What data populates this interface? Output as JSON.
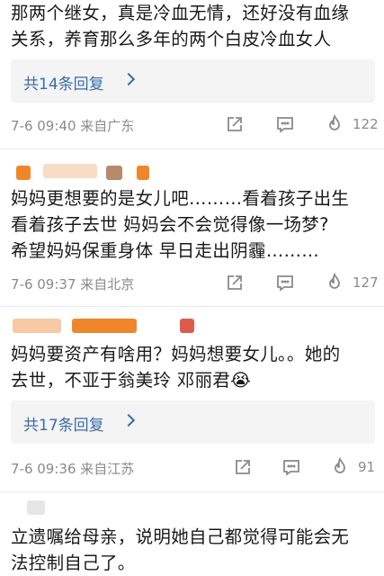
{
  "comments": [
    {
      "text": "那两个继女，真是冷血无情，还好没有血缘\n关系，养育那么多年的两个白皮冷血女人",
      "replies": "共14条回复",
      "meta": "7-6 09:40  来自广东",
      "likes": "122"
    },
    {
      "text": "妈妈更想要的是女儿吧………看着孩子出生\n看着孩子去世 妈妈会不会觉得像一场梦?\n希望妈妈保重身体 早日走出阴霾………",
      "meta": "7-6 09:37  来自北京",
      "likes": "127"
    },
    {
      "text": "妈妈要资产有啥用？妈妈想要女儿。。她的\n去世，不亚于翁美玲 邓丽君😭",
      "replies": "共17条回复",
      "meta": "7-6 09:36  来自江苏",
      "likes": "91"
    },
    {
      "text": "立遗嘱给母亲，说明她自己都觉得可能会无\n法控制自己了。"
    }
  ],
  "colors": {
    "link": "#3a6ca8",
    "meta": "#8a8a8a",
    "reply_bg": "#f4f4f4",
    "avatar_blur": [
      "#f0862a",
      "#f7c9a4",
      "#b78a6c",
      "#e05a4a"
    ]
  },
  "icons": [
    "share-icon",
    "comment-icon",
    "like-flame-icon"
  ]
}
